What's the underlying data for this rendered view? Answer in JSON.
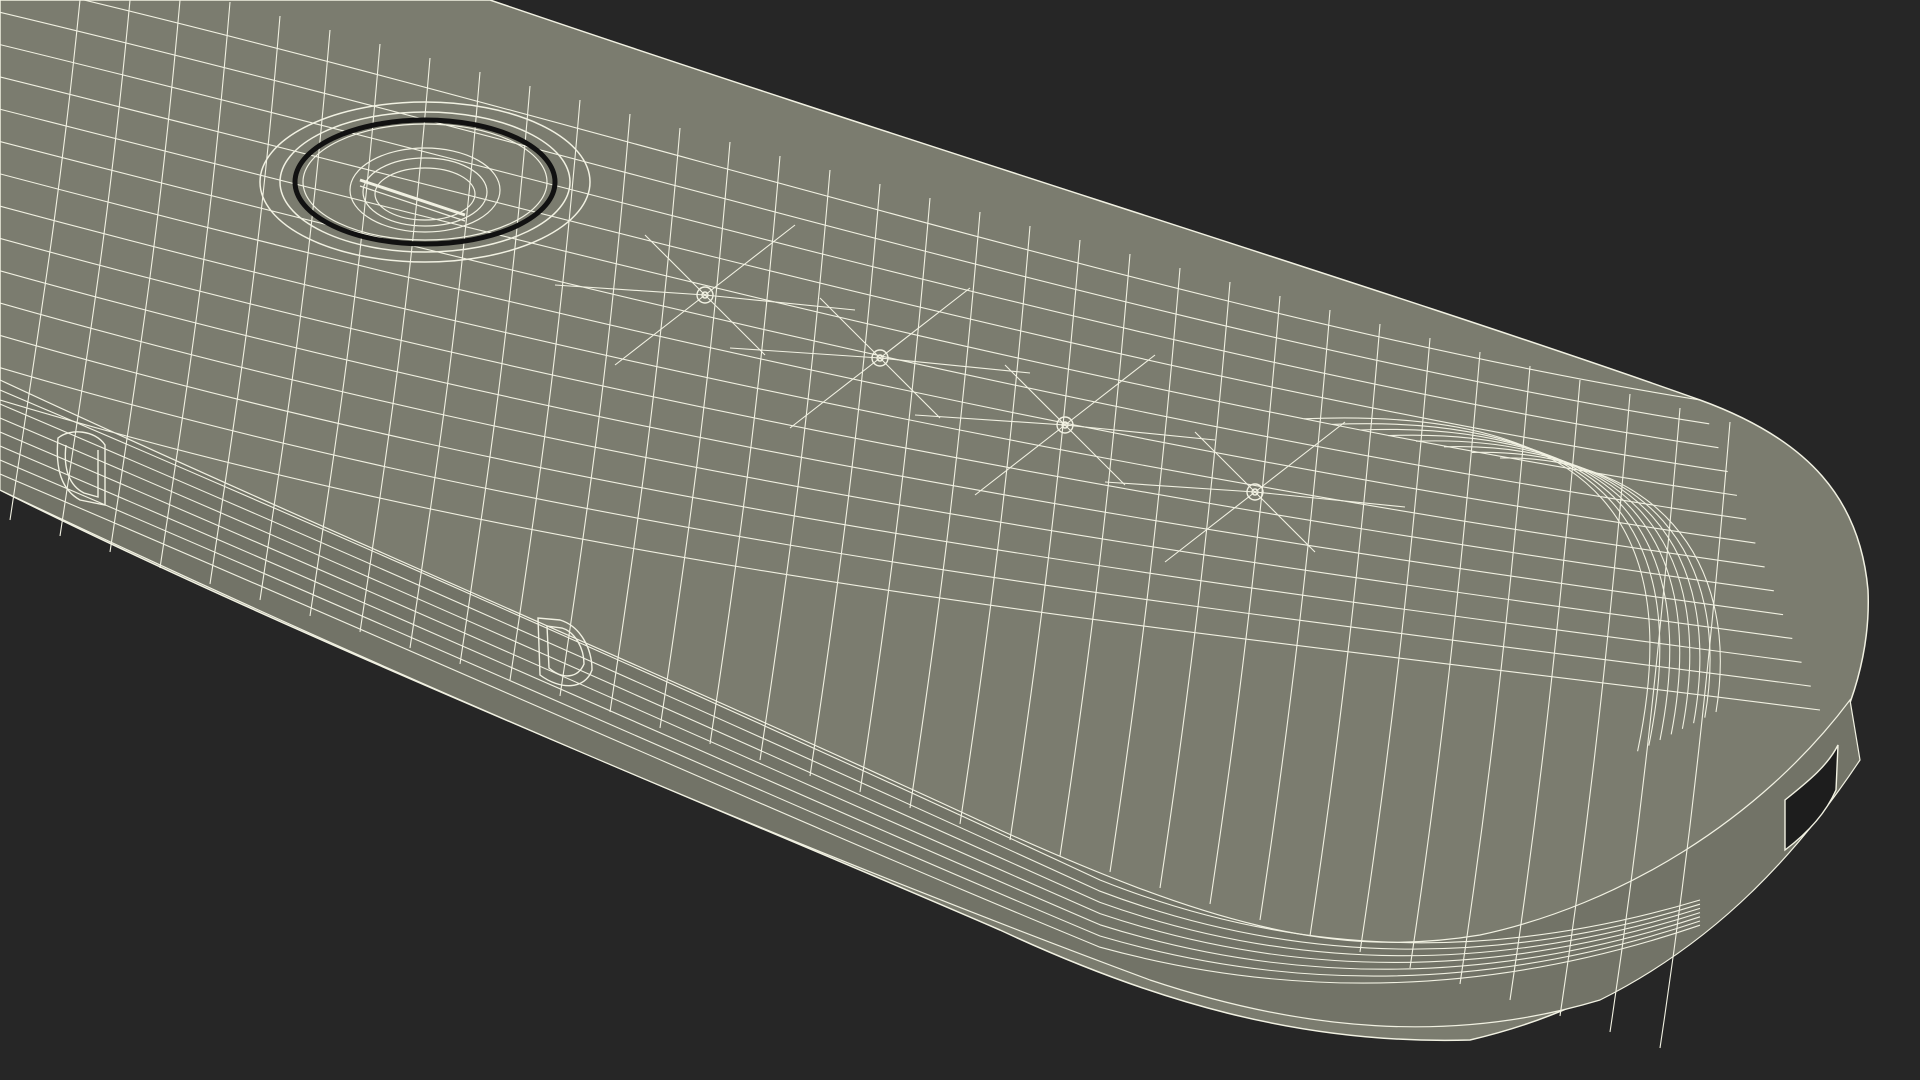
{
  "scene": {
    "subject": "usb-stick-wireframe-model",
    "render_mode": "wireframe",
    "colors": {
      "background": "#262626",
      "surface": "#7b7c6f",
      "surface_shade": "#727367",
      "wire": "#f1f1e2",
      "cavity": "#1d1d1d"
    },
    "icons": [
      "status-led-icon",
      "screw-icon",
      "strap-slot-icon",
      "usb-port-icon"
    ]
  }
}
